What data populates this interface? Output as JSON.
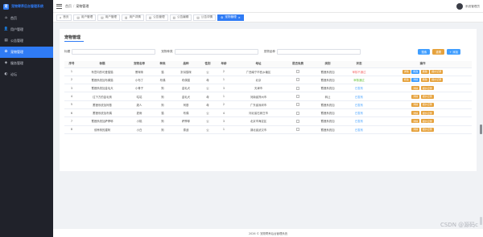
{
  "app": {
    "title": "宠物寄养后台管理系统",
    "logo": "宠"
  },
  "sidebar": {
    "items": [
      {
        "label": "首页",
        "icon": "home-icon",
        "glyph": "⌂",
        "active": false
      },
      {
        "label": "用户管理",
        "icon": "user-icon",
        "glyph": "👤",
        "active": false
      },
      {
        "label": "公告管理",
        "icon": "notice-icon",
        "glyph": "▤",
        "active": false
      },
      {
        "label": "宠物管理",
        "icon": "pet-icon",
        "glyph": "✿",
        "active": true
      },
      {
        "label": "服务管理",
        "icon": "service-icon",
        "glyph": "◈",
        "active": false
      },
      {
        "label": "论坛",
        "icon": "forum-icon",
        "glyph": "◐",
        "active": false
      }
    ]
  },
  "header": {
    "breadcrumb": {
      "home": "首页",
      "current": "宠物管理"
    },
    "user_name": "系统管理员"
  },
  "tabs": [
    {
      "label": "首页",
      "icon": "home-icon",
      "glyph": "⌂",
      "active": false
    },
    {
      "label": "用户管理",
      "icon": "doc-icon",
      "glyph": "▤",
      "active": false
    },
    {
      "label": "用户管理",
      "icon": "doc-icon",
      "glyph": "▤",
      "active": false
    },
    {
      "label": "用户详情",
      "icon": "doc-icon",
      "glyph": "▤",
      "active": false
    },
    {
      "label": "公告管理",
      "icon": "doc-icon",
      "glyph": "▤",
      "active": false
    },
    {
      "label": "公告编辑",
      "icon": "doc-icon",
      "glyph": "▤",
      "active": false
    },
    {
      "label": "公告详情",
      "icon": "doc-icon",
      "glyph": "▤",
      "active": false
    },
    {
      "label": "宠物管理",
      "icon": "gear-icon",
      "glyph": "⚙",
      "active": true,
      "close": "×"
    }
  ],
  "page": {
    "title": "宠物管理"
  },
  "filters": [
    {
      "label": "标题",
      "placeholder": ""
    },
    {
      "label": "宠物种类",
      "placeholder": ""
    },
    {
      "label": "宠物品种",
      "placeholder": ""
    }
  ],
  "buttons": {
    "search": "搜索",
    "reset": "重置",
    "add": "+ 添加"
  },
  "table": {
    "columns": [
      "序号",
      "标题",
      "宠物名称",
      "种类",
      "品种",
      "性别",
      "年龄",
      "地址",
      "是否免费",
      "类别",
      "状态",
      "操作"
    ],
    "rows": [
      {
        "idx": "1",
        "title": "有意向的可爱猫猫",
        "name": "黑咪咪",
        "kind": "猫",
        "breed": "折耳猫咪",
        "sex": "公",
        "age": "2",
        "addr": "广西南宁市西乡塘区",
        "free": "",
        "type": "蓄狸系统加",
        "status": "审核不通过",
        "status_class": "tag-red",
        "ops": [
          [
            "详情",
            "op-orange"
          ],
          [
            "修改",
            "op-blue"
          ],
          [
            "删除",
            "op-orange"
          ],
          [
            "报价记录",
            "op-orange"
          ]
        ]
      },
      {
        "idx": "2",
        "title": "蓄狸系统加布偶猫",
        "name": "小布丁",
        "kind": "布偶",
        "breed": "布偶猫",
        "sex": "母",
        "age": "1",
        "addr": "北京",
        "free": "",
        "type": "蓄狸系统加",
        "status": "审核通过",
        "status_class": "tag-green",
        "ops": [
          [
            "修改",
            "op-orange"
          ],
          [
            "详情",
            "op-blue"
          ],
          [
            "删除",
            "op-orange"
          ],
          [
            "报价记录",
            "op-orange"
          ]
        ]
      },
      {
        "idx": "3",
        "title": "蓄狸系统加金毛犬",
        "name": "小骨子",
        "kind": "狗",
        "breed": "金毛犬",
        "sex": "公",
        "age": "3",
        "addr": "天津市",
        "free": "",
        "type": "蓄狸系统加",
        "status": "已发布",
        "status_class": "tag-blue",
        "ops": [
          [
            "详情",
            "op-orange"
          ],
          [
            "报价记录",
            "op-orange"
          ]
        ]
      },
      {
        "idx": "4",
        "title": "往下方的金毛狗",
        "name": "咕咕",
        "kind": "狗",
        "breed": "金毛犬",
        "sex": "母",
        "age": "1",
        "addr": "河南省郑州市",
        "free": "",
        "type": "转让",
        "status": "已发布",
        "status_class": "tag-blue",
        "ops": [
          [
            "详情",
            "op-orange"
          ],
          [
            "报价记录",
            "op-orange"
          ]
        ]
      },
      {
        "idx": "5",
        "title": "蓄狸系统加柯基",
        "name": "超人",
        "kind": "狗",
        "breed": "柯基",
        "sex": "母",
        "age": "2",
        "addr": "广东省深圳市",
        "free": "",
        "type": "蓄狸系统加",
        "status": "已发布",
        "status_class": "tag-blue",
        "ops": [
          [
            "详情",
            "op-orange"
          ],
          [
            "报价记录",
            "op-orange"
          ]
        ]
      },
      {
        "idx": "6",
        "title": "蓄狸系统加布偶",
        "name": "夏雨",
        "kind": "猫",
        "breed": "布偶",
        "sex": "公",
        "age": "4",
        "addr": "河北省石家庄市",
        "free": "",
        "type": "蓄狸系统加",
        "status": "已发布",
        "status_class": "tag-blue",
        "ops": [
          [
            "详情",
            "op-orange"
          ],
          [
            "报价记录",
            "op-orange"
          ]
        ]
      },
      {
        "idx": "7",
        "title": "蓄狸系统加萨摩耶",
        "name": "小桃",
        "kind": "狗",
        "breed": "萨摩耶",
        "sex": "公",
        "age": "3",
        "addr": "北京市海淀区",
        "free": "",
        "type": "蓄狸系统加",
        "status": "已发布",
        "status_class": "tag-blue",
        "ops": [
          [
            "详情",
            "op-orange"
          ],
          [
            "报价记录",
            "op-orange"
          ]
        ]
      },
      {
        "idx": "8",
        "title": "领养狗的建阿",
        "name": "小白",
        "kind": "狗",
        "breed": "泰迪",
        "sex": "公",
        "age": "1",
        "addr": "湖北省武汉市",
        "free": "",
        "type": "蓄狸系统加",
        "status": "已发布",
        "status_class": "tag-blue",
        "ops": [
          [
            "详情",
            "op-orange"
          ],
          [
            "报价记录",
            "op-orange"
          ]
        ]
      }
    ]
  },
  "footer": {
    "text": "2026 © 宠物寄养后台管理系统"
  },
  "watermark": "CSDN @源码c"
}
